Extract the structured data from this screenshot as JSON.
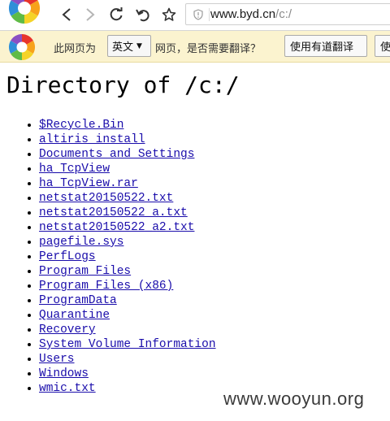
{
  "toolbar": {
    "url_host": "www.byd.cn",
    "url_path": "/c:/",
    "icons": [
      "browser-logo-icon",
      "back-icon",
      "forward-icon",
      "reload-icon",
      "undo-icon",
      "star-icon",
      "shield-icon"
    ]
  },
  "translate_bar": {
    "prefix": "此网页为",
    "language": "英文",
    "suffix": "网页，是否需要翻译？",
    "translate_button": "使用有道翻译",
    "cut_button": "使"
  },
  "page": {
    "title": "Directory of /c:/",
    "entries": [
      "$Recycle.Bin",
      "altiris install",
      "Documents and Settings",
      "ha_TcpView",
      "ha_TcpView.rar",
      "netstat20150522.txt",
      "netstat20150522_a.txt",
      "netstat20150522_a2.txt",
      "pagefile.sys",
      "PerfLogs",
      "Program Files",
      "Program Files (x86)",
      "ProgramData",
      "Quarantine",
      "Recovery",
      "System Volume Information",
      "Users",
      "Windows",
      "wmic.txt"
    ]
  },
  "watermark": "www.wooyun.org",
  "colors": {
    "link": "#1a0dab",
    "translate_bar_bg": "#fbf3cf"
  }
}
